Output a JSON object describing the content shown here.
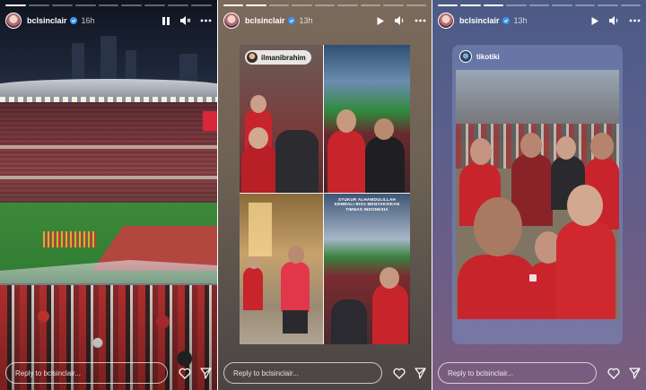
{
  "stories": [
    {
      "username": "bclsinclair",
      "time": "16h",
      "reply_placeholder": "Reply to bclsinclair...",
      "state": "playing",
      "progress": [
        1,
        0,
        0,
        0,
        0,
        0,
        0,
        0,
        0
      ]
    },
    {
      "username": "bclsinclair",
      "time": "13h",
      "reply_placeholder": "Reply to bclsinclair...",
      "state": "paused",
      "mention": "ilmanibrahim",
      "caption": "SYUKUR ALHAMDULILLAH KEMBALI BISA MENYAKSIKAN TIMNAS INDONESIA",
      "progress": [
        1,
        1,
        0,
        0,
        0,
        0,
        0,
        0,
        0
      ]
    },
    {
      "username": "bclsinclair",
      "time": "13h",
      "reply_placeholder": "Reply to bclsinclair...",
      "state": "paused",
      "repost_user": "tikotiki",
      "progress": [
        1,
        1,
        1,
        0,
        0,
        0,
        0,
        0,
        0
      ]
    }
  ],
  "colors": {
    "jersey_red": "#c8242c",
    "story_white": "#ffffff"
  },
  "icons": [
    "verified-icon",
    "pause-icon",
    "play-icon",
    "mute-icon",
    "volume-icon",
    "more-icon",
    "heart-icon",
    "send-icon"
  ]
}
